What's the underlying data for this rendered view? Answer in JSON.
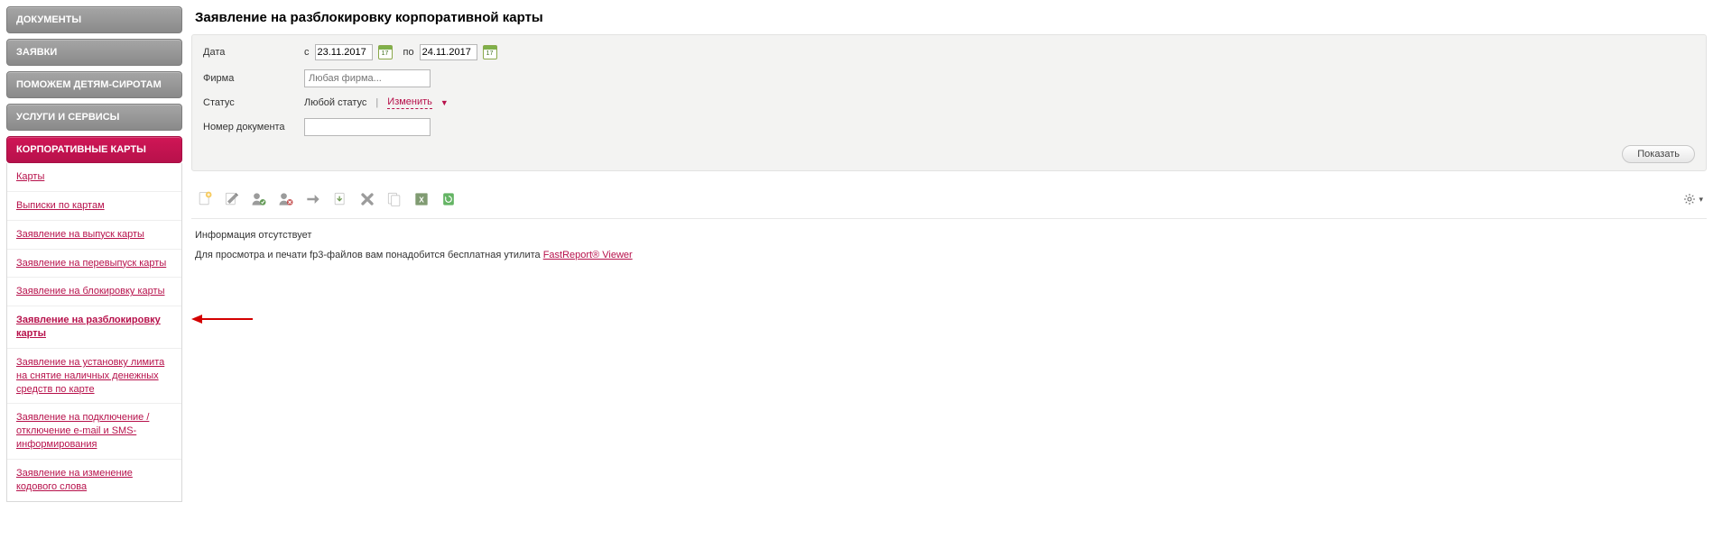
{
  "sidebar": {
    "nav": [
      {
        "label": "ДОКУМЕНТЫ"
      },
      {
        "label": "ЗАЯВКИ"
      },
      {
        "label": "ПОМОЖЕМ ДЕТЯМ-СИРОТАМ"
      },
      {
        "label": "УСЛУГИ И СЕРВИСЫ"
      },
      {
        "label": "КОРПОРАТИВНЫЕ КАРТЫ",
        "active": true
      }
    ],
    "sub": [
      "Карты",
      "Выписки по картам",
      "Заявление на выпуск карты",
      "Заявление на перевыпуск карты",
      "Заявление на блокировку карты",
      "Заявление на разблокировку карты",
      "Заявление на установку лимита на снятие наличных денежных средств по карте",
      "Заявление на подключение / отключение e-mail и SMS-информирования",
      "Заявление на изменение кодового слова"
    ],
    "sub_current_index": 5
  },
  "page": {
    "title": "Заявление на разблокировку корпоративной карты"
  },
  "filters": {
    "labels": {
      "date": "Дата",
      "firm": "Фирма",
      "status": "Статус",
      "docnum": "Номер документа"
    },
    "date": {
      "prefix_from": "с",
      "from": "23.11.2017",
      "prefix_to": "по",
      "to": "24.11.2017"
    },
    "firm_placeholder": "Любая фирма...",
    "status_any": "Любой статус",
    "status_change": "Изменить",
    "docnum_value": "",
    "show_label": "Показать"
  },
  "messages": {
    "empty": "Информация отсутствует",
    "viewer_prefix": "Для просмотра и печати fp3-файлов вам понадобится бесплатная утилита ",
    "viewer_link": "FastReport® Viewer"
  }
}
